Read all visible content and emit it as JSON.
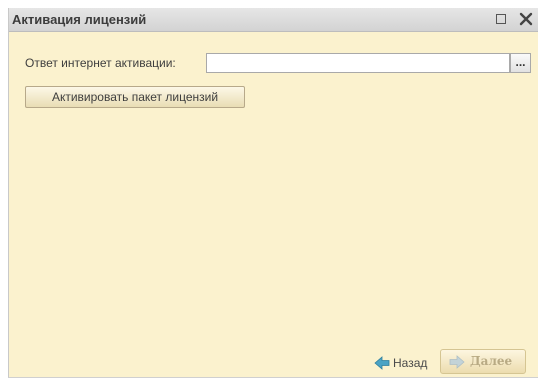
{
  "window": {
    "title": "Активация лицензий"
  },
  "titlebar": {
    "icons": [
      "maximize-icon",
      "close-icon"
    ]
  },
  "form": {
    "response_label": "Ответ интернет активации:",
    "response_value": "",
    "choose_button_label": "...",
    "activate_button_label": "Активировать пакет лицензий"
  },
  "nav": {
    "back_label": "Назад",
    "back_icon": "arrow-left-icon",
    "next_label": "Далее",
    "next_icon": "arrow-right-icon",
    "next_enabled": false
  },
  "colors": {
    "background": "#fbf2ce",
    "titlebar": "#dadada",
    "button": "#f2e8c8",
    "arrow_back": "#4aa3c4",
    "arrow_next_disabled": "#c3d3d8"
  }
}
